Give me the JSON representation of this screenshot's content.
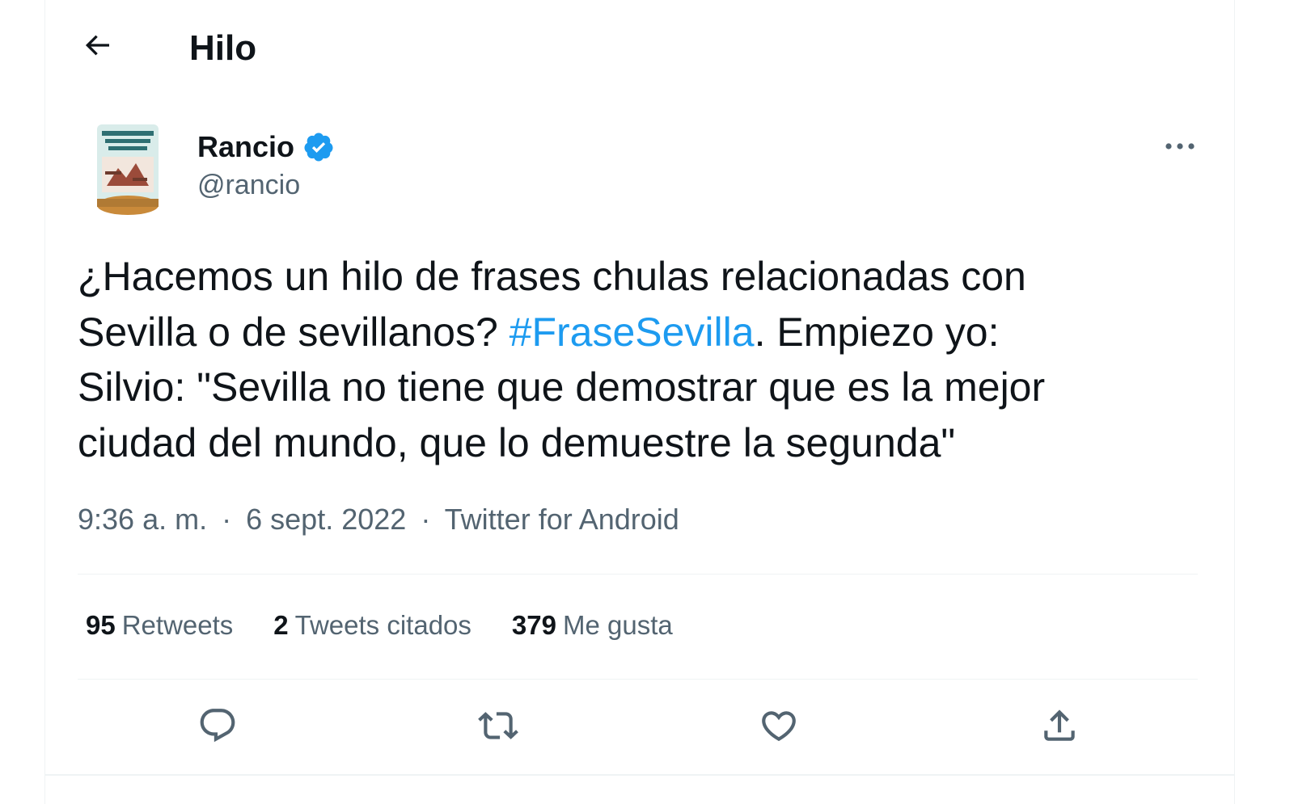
{
  "header": {
    "title": "Hilo",
    "back_icon": "arrow-left-icon"
  },
  "author": {
    "name": "Rancio",
    "handle": "@rancio",
    "verified": true,
    "verified_color": "#1d9bf0"
  },
  "tweet": {
    "line1": "¿Hacemos un hilo de frases chulas relacionadas con",
    "line2_pre": "Sevilla o de sevillanos? ",
    "hashtag": "#FraseSevilla",
    "line2_post": ". Empiezo yo:",
    "line3": "Silvio: \"Sevilla no tiene que demostrar que es la mejor",
    "line4": "ciudad del mundo, que lo demuestre la segunda\""
  },
  "meta": {
    "time": "9:36 a. m.",
    "dot": "·",
    "date": "6 sept. 2022",
    "source": "Twitter for Android"
  },
  "stats": [
    {
      "count": "95",
      "label": "Retweets"
    },
    {
      "count": "2",
      "label": "Tweets citados"
    },
    {
      "count": "379",
      "label": "Me gusta"
    }
  ],
  "actions": [
    "reply-icon",
    "retweet-icon",
    "like-icon",
    "share-icon"
  ],
  "colors": {
    "text": "#0f1419",
    "secondary": "#536471",
    "accent": "#1d9bf0",
    "divider": "#eff3f4"
  }
}
